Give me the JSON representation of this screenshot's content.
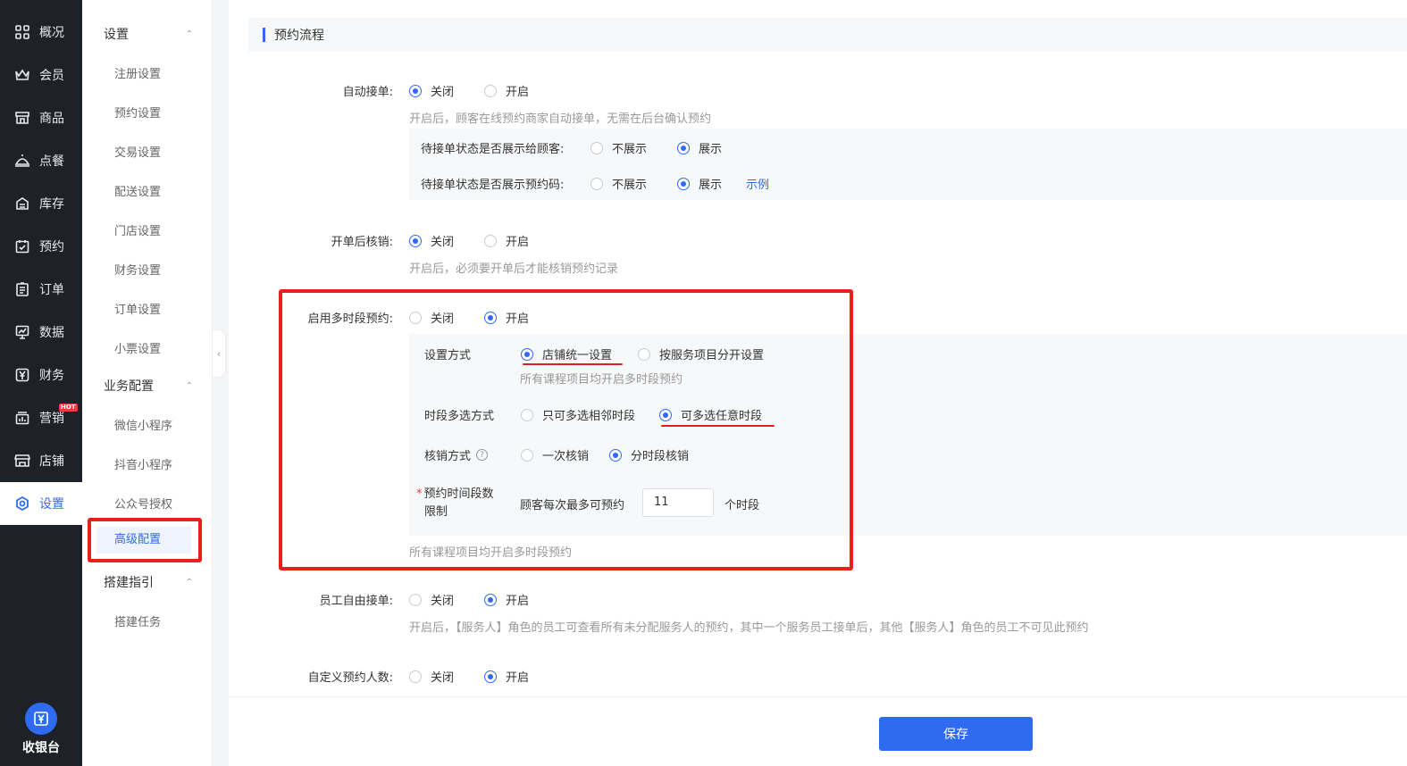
{
  "nav": {
    "items": [
      {
        "label": "概况",
        "icon": "grid-icon"
      },
      {
        "label": "会员",
        "icon": "crown-icon"
      },
      {
        "label": "商品",
        "icon": "shop-icon"
      },
      {
        "label": "点餐",
        "icon": "dish-icon"
      },
      {
        "label": "库存",
        "icon": "inventory-icon"
      },
      {
        "label": "预约",
        "icon": "calendar-check-icon"
      },
      {
        "label": "订单",
        "icon": "order-icon"
      },
      {
        "label": "数据",
        "icon": "chart-icon"
      },
      {
        "label": "财务",
        "icon": "yen-icon"
      },
      {
        "label": "营销",
        "icon": "marketing-icon",
        "badge": "HOT"
      },
      {
        "label": "店铺",
        "icon": "store-icon"
      },
      {
        "label": "设置",
        "icon": "gear-icon",
        "active": true
      }
    ],
    "cashier_label": "收银台"
  },
  "subnav": {
    "group1": "设置",
    "group1_items": [
      "注册设置",
      "预约设置",
      "交易设置",
      "配送设置",
      "门店设置",
      "财务设置",
      "订单设置",
      "小票设置"
    ],
    "group2": "业务配置",
    "group2_items": [
      "微信小程序",
      "抖音小程序",
      "公众号授权",
      "高级配置"
    ],
    "group3": "搭建指引",
    "group3_items": [
      "搭建任务"
    ]
  },
  "section_title": "预约流程",
  "auto_accept": {
    "label": "自动接单:",
    "off": "关闭",
    "on": "开启",
    "hint": "开启后，顾客在线预约商家自动接单，无需在后台确认预约",
    "row1_label": "待接单状态是否展示给顾客:",
    "row1_off": "不展示",
    "row1_on": "展示",
    "row2_label": "待接单状态是否展示预约码:",
    "row2_off": "不展示",
    "row2_on": "展示",
    "example": "示例"
  },
  "verify_after_open": {
    "label": "开单后核销:",
    "off": "关闭",
    "on": "开启",
    "hint": "开启后，必须要开单后才能核销预约记录"
  },
  "multi_slot": {
    "label": "启用多时段预约:",
    "off": "关闭",
    "on": "开启",
    "method_label": "设置方式",
    "method_opt1": "店铺统一设置",
    "method_opt2": "按服务项目分开设置",
    "method_hint": "所有课程项目均开启多时段预约",
    "select_label": "时段多选方式",
    "select_opt1": "只可多选相邻时段",
    "select_opt2": "可多选任意时段",
    "verify_label": "核销方式",
    "verify_opt1": "一次核销",
    "verify_opt2": "分时段核销",
    "limit_label_1": "预约时间段数",
    "limit_label_2": "限制",
    "limit_prefix": "顾客每次最多可预约",
    "limit_value": "11",
    "limit_suffix": "个时段",
    "bottom_hint": "所有课程项目均开启多时段预约"
  },
  "staff_free": {
    "label": "员工自由接单:",
    "off": "关闭",
    "on": "开启",
    "hint": "开启后，【服务人】角色的员工可查看所有未分配服务人的预约，其中一个服务员工接单后，其他【服务人】角色的员工不可见此预约"
  },
  "custom_count": {
    "label": "自定义预约人数:",
    "off": "关闭",
    "on": "开启"
  },
  "save_label": "保存"
}
